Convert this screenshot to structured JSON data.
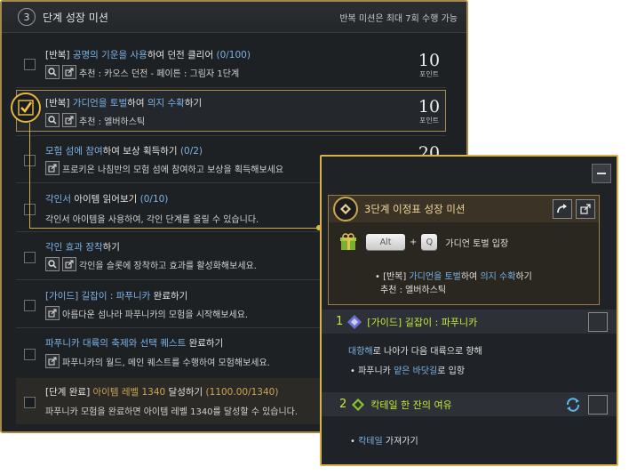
{
  "mission": {
    "number": "3",
    "title": "단계 성장 미션",
    "note": "반복 미션은 최대 7회 수행 가능",
    "rows": [
      {
        "prefix": "[반복] ",
        "hl1": "공명의 기운을 사용",
        "mid": "하여 던전 클리어 ",
        "progress": "(0/100)",
        "sub": "추천 : 카오스 던전 - 페이튼 : 그림자 1단계",
        "points": "10",
        "points_label": "포인트"
      },
      {
        "prefix": "[반복] ",
        "hl1": "가디언을 토벌",
        "mid": "하여 ",
        "hl2": "의지 수확",
        "end": "하기",
        "sub": "추천 : 엘버하스틱",
        "points": "10",
        "points_label": "포인트"
      },
      {
        "hl1": "모험 섬에 참여",
        "mid": "하여 보상 획득하기 ",
        "progress": "(0/2)",
        "sub": "프로키온 나침반의 모험 섬에 참여하고 보상을 획득해보세요",
        "points": "20"
      },
      {
        "hl1": "각인서",
        "mid": " 아이템 읽어보기 ",
        "progress": "(0/10)",
        "sub": "각인서 아이템을 사용하여, 각인 단계를 올릴 수 있습니다."
      },
      {
        "hl1": "각인 효과 장착",
        "mid": "하기",
        "sub": "각인을 슬롯에 장착하고 효과를 활성화해보세요."
      },
      {
        "hl1": "[가이드] 길잡이 : 파푸니카",
        "mid": " 완료하기",
        "sub": "아름다운 섬나라 파푸니카의 모험을 시작해보세요."
      },
      {
        "hl1": "파푸니카 대륙의 축제와 선택 퀘스트",
        "mid": " 완료하기",
        "sub": "파푸니카의 월드, 메인 퀘스트를 수행하여 모험해보세요."
      },
      {
        "prefix": "[단계 완료] ",
        "hl1": "아이템 레벨 1340",
        "mid": " 달성하기 ",
        "progress": "(1100.00/1340)",
        "sub": "파푸니카 모험을 완료하면 아이템 레벨 1340를 달성할 수 있습니다."
      }
    ]
  },
  "navigator": {
    "card": {
      "title": "3단계 이정표 성장 미션",
      "key1": "Alt",
      "plus": "+",
      "key2": "Q",
      "shortcut_label": "가디언 토벌 입장",
      "line1_prefix": "[반복] ",
      "line1_hl1": "가디언을 토벌",
      "line1_mid": "하여 ",
      "line1_hl2": "의지 수확",
      "line1_end": "하기",
      "line2": "추천 : 엘버하스틱"
    },
    "section1": {
      "num": "1",
      "title": "[가이드] 길잡이 : 파푸니카",
      "line1_hl": "대항해",
      "line1_rest": "로 나아가 다음 대륙으로 향해",
      "line2_pre": "• 파푸니카 ",
      "line2_hl": "얕은 바닷길",
      "line2_rest": "로 입항"
    },
    "section2": {
      "num": "2",
      "title": "칵테일 한 잔의 여유",
      "line1_pre": "• ",
      "line1_hl": "칵테일",
      "line1_rest": " 가져가기"
    }
  },
  "colors": {
    "gold_border": "#d6b24a",
    "green": "#c3ea3a",
    "blue": "#79b3e6",
    "gold_text": "#c9a553"
  }
}
